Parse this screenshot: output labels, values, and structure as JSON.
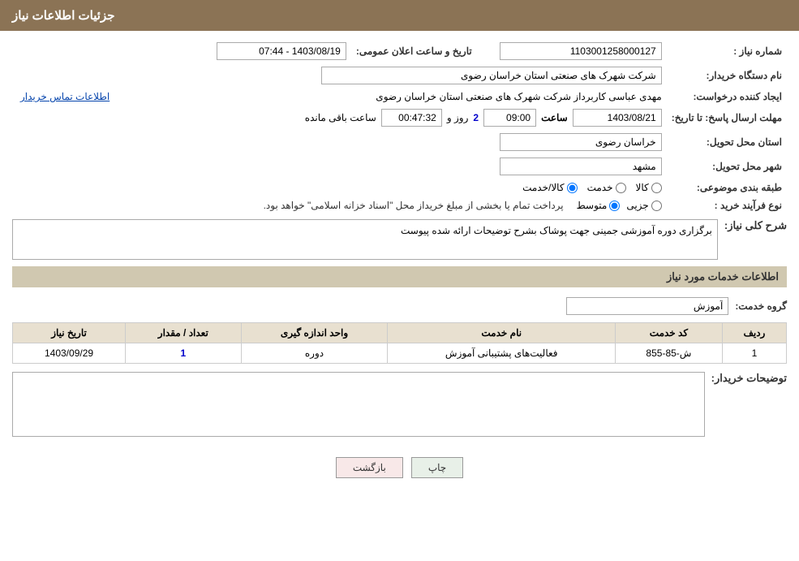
{
  "header": {
    "title": "جزئیات اطلاعات نیاز"
  },
  "fields": {
    "need_number_label": "شماره نیاز :",
    "need_number_value": "1103001258000127",
    "buyer_org_label": "نام دستگاه خریدار:",
    "buyer_org_value": "شرکت شهرک های صنعتی استان خراسان رضوی",
    "creator_label": "ایجاد کننده درخواست:",
    "creator_value": "مهدی عباسی کاربرداز شرکت شهرک های صنعتی استان خراسان رضوی",
    "contact_link": "اطلاعات تماس خریدار",
    "deadline_label": "مهلت ارسال پاسخ: تا تاریخ:",
    "deadline_date": "1403/08/21",
    "deadline_time_label": "ساعت",
    "deadline_time": "09:00",
    "remaining_days_label": "روز و",
    "remaining_days": "2",
    "remaining_time": "00:47:32",
    "remaining_suffix": "ساعت باقی مانده",
    "announce_label": "تاریخ و ساعت اعلان عمومی:",
    "announce_value": "1403/08/19 - 07:44",
    "province_label": "استان محل تحویل:",
    "province_value": "خراسان رضوی",
    "city_label": "شهر محل تحویل:",
    "city_value": "مشهد",
    "category_label": "طبقه بندی موضوعی:",
    "category_kala": "کالا",
    "category_khadamat": "خدمت",
    "category_kala_khadamat": "کالا/خدمت",
    "purchase_type_label": "نوع فرآیند خرید :",
    "purchase_type_jazee": "جزیی",
    "purchase_type_motavasset": "متوسط",
    "purchase_type_note": "پرداخت تمام یا بخشی از مبلغ خریداز محل \"اسناد خزانه اسلامی\" خواهد بود.",
    "description_section_label": "شرح کلی نیاز:",
    "description_value": "برگزاری دوره آموزشی جمینی جهت پوشاک  بشرح توضیحات ارائه شده پیوست",
    "services_section_label": "اطلاعات خدمات مورد نیاز",
    "service_group_label": "گروه خدمت:",
    "service_group_value": "آموزش",
    "table_headers": {
      "row_num": "ردیف",
      "service_code": "کد خدمت",
      "service_name": "نام خدمت",
      "unit": "واحد اندازه گیری",
      "quantity": "تعداد / مقدار",
      "need_date": "تاریخ نیاز"
    },
    "table_rows": [
      {
        "row_num": "1",
        "service_code": "ش-85-855",
        "service_name": "فعالیت‌های پشتیبانی آموزش",
        "unit": "دوره",
        "quantity": "1",
        "need_date": "1403/09/29"
      }
    ],
    "buyer_notes_label": "توضیحات خریدار:"
  },
  "buttons": {
    "print": "چاپ",
    "back": "بازگشت"
  }
}
